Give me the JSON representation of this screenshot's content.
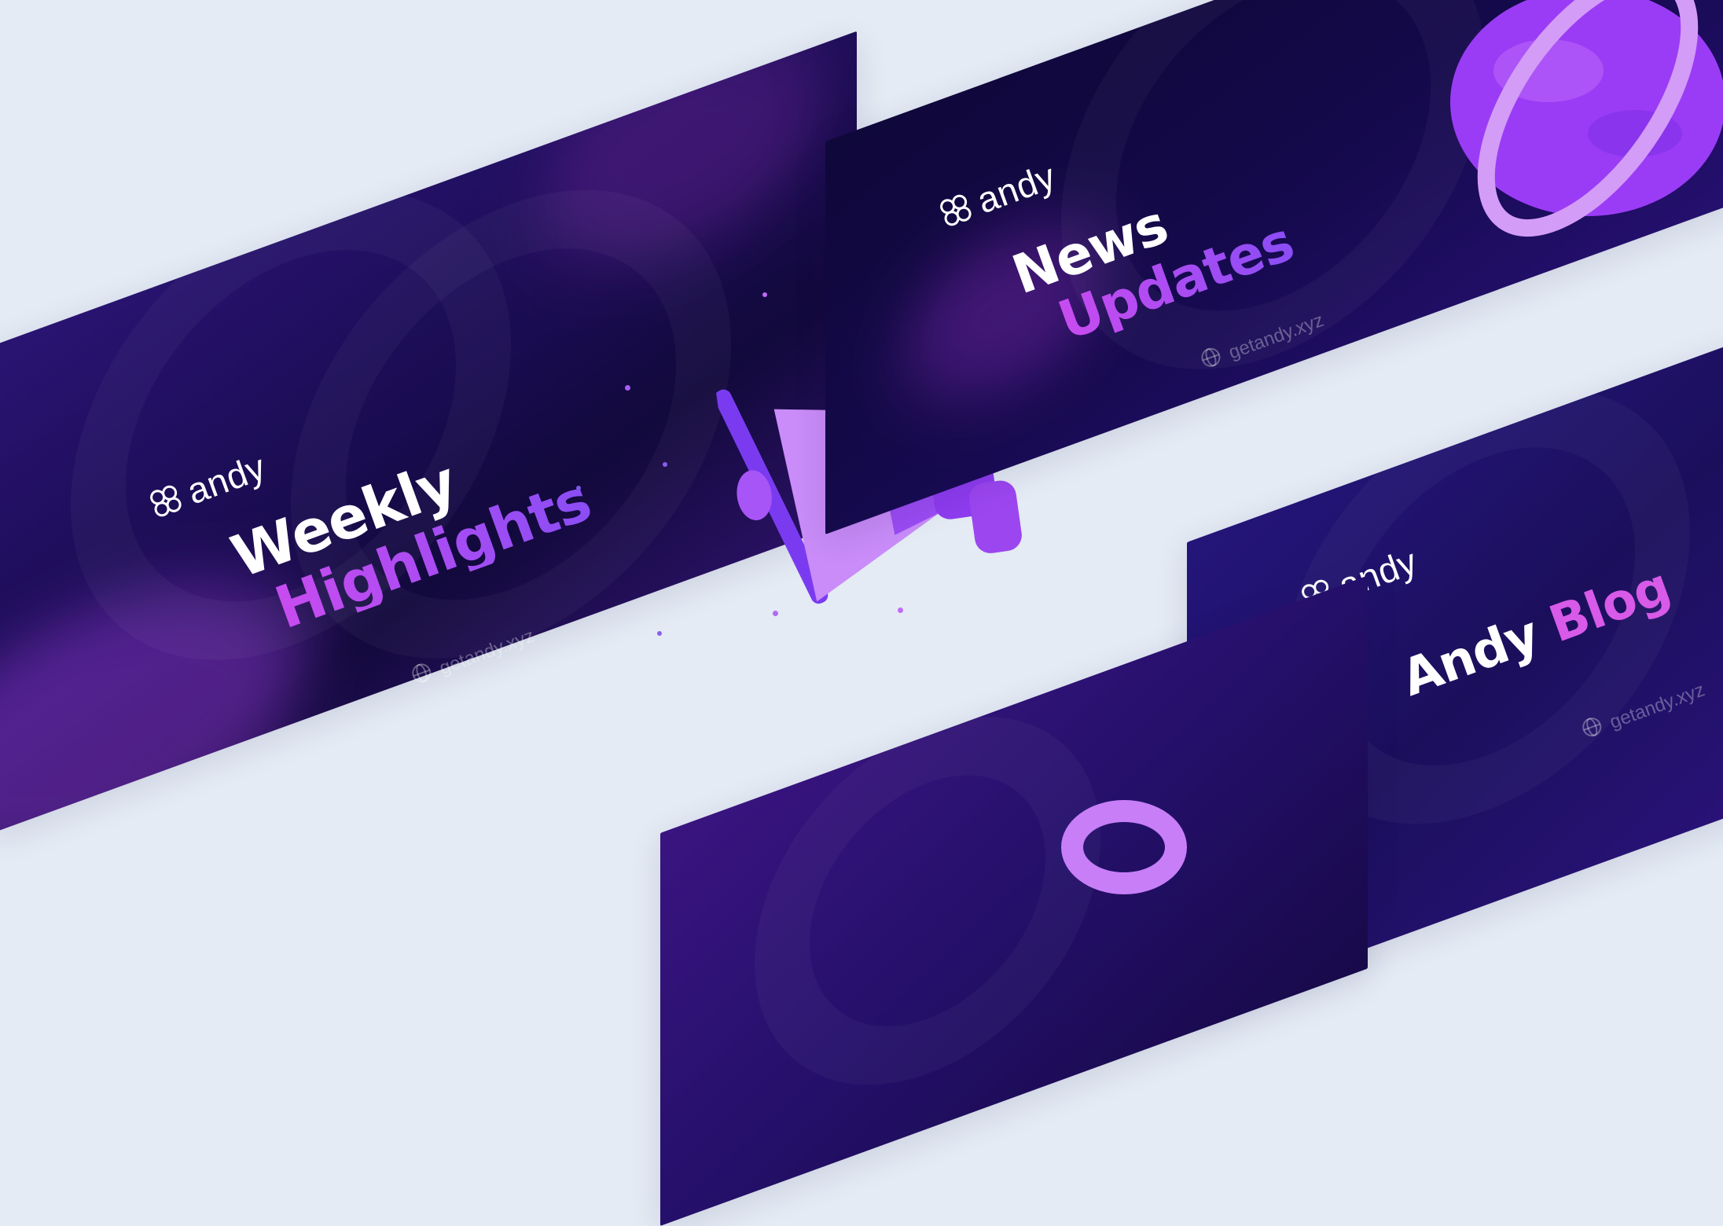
{
  "cards": {
    "weekly": {
      "logo": "andy",
      "line1": "Weekly",
      "line2": "Highlights",
      "site": "getandy.xyz"
    },
    "news": {
      "logo": "andy",
      "line1": "News",
      "line2": "Updates",
      "site": "getandy.xyz"
    },
    "blog": {
      "logo": "andy",
      "line1": "Andy",
      "line2": "Blog",
      "site": "getandy.xyz"
    }
  },
  "colors": {
    "background": "#e4ebf4",
    "card_dark": "#12093f",
    "accent_purple": "#c052f0",
    "accent_violet": "#8a4df5"
  },
  "icons": [
    "andy-logo-icon",
    "globe-icon",
    "megaphone-icon",
    "planet-icon"
  ]
}
